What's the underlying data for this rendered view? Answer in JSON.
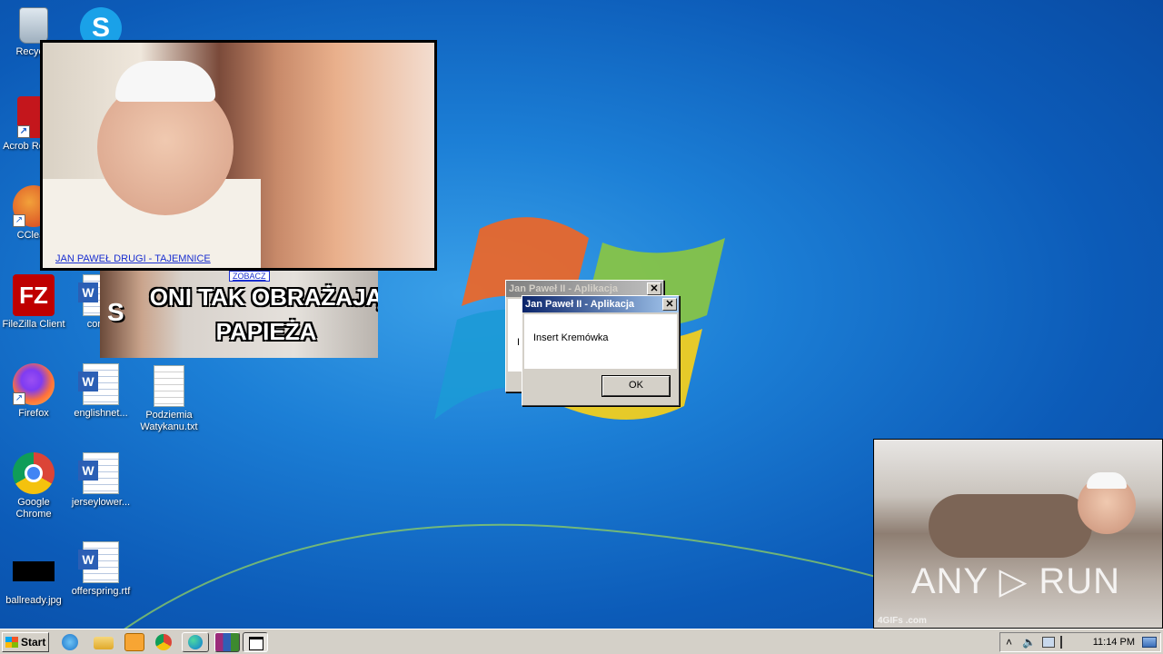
{
  "desktop": {
    "icons": [
      {
        "label": "Recycle",
        "icon": "recycle-bin-icon"
      },
      {
        "label": "",
        "icon": "skype-icon",
        "glyph": "S"
      },
      {
        "label": "Acrob Reader",
        "icon": "acrobat-reader-icon"
      },
      {
        "label": "CClean",
        "icon": "ccleaner-icon"
      },
      {
        "label": "FileZilla Client",
        "icon": "filezilla-icon",
        "glyph": "FZ"
      },
      {
        "label": "Firefox",
        "icon": "firefox-icon"
      },
      {
        "label": "Google Chrome",
        "icon": "chrome-icon"
      },
      {
        "label": "ballready.jpg",
        "icon": "image-file-icon"
      },
      {
        "label": "confer",
        "icon": "word-doc-icon"
      },
      {
        "label": "englishnet...",
        "icon": "word-doc-icon"
      },
      {
        "label": "jerseylower...",
        "icon": "word-doc-icon"
      },
      {
        "label": "offerspring.rtf",
        "icon": "word-doc-icon"
      },
      {
        "label": "Podziemia Watykanu.txt",
        "icon": "text-file-icon"
      }
    ]
  },
  "popups": {
    "gif1": {
      "link": "JAN PAWEŁ DRUGI - TAJEMNICE"
    },
    "gif2": {
      "badge": "ZOBACZ",
      "line1": "ONI TAK OBRAŻAJĄ",
      "line2": "PAPIEŻA",
      "side": "S"
    },
    "gif3": {
      "watermark": "ANY ▷ RUN",
      "source": "4GIFs .com"
    }
  },
  "dialogs": {
    "back": {
      "title": "Jan Paweł II - Aplikacja",
      "close": "✕",
      "text_fragment": "I"
    },
    "front": {
      "title": "Jan Paweł II - Aplikacja",
      "close": "✕",
      "message": "Insert Kremówka",
      "ok_label": "OK"
    }
  },
  "taskbar": {
    "start_label": "Start",
    "tray": {
      "show_hidden": "˄",
      "volume": "🔈",
      "clock": "11:14 PM"
    }
  }
}
